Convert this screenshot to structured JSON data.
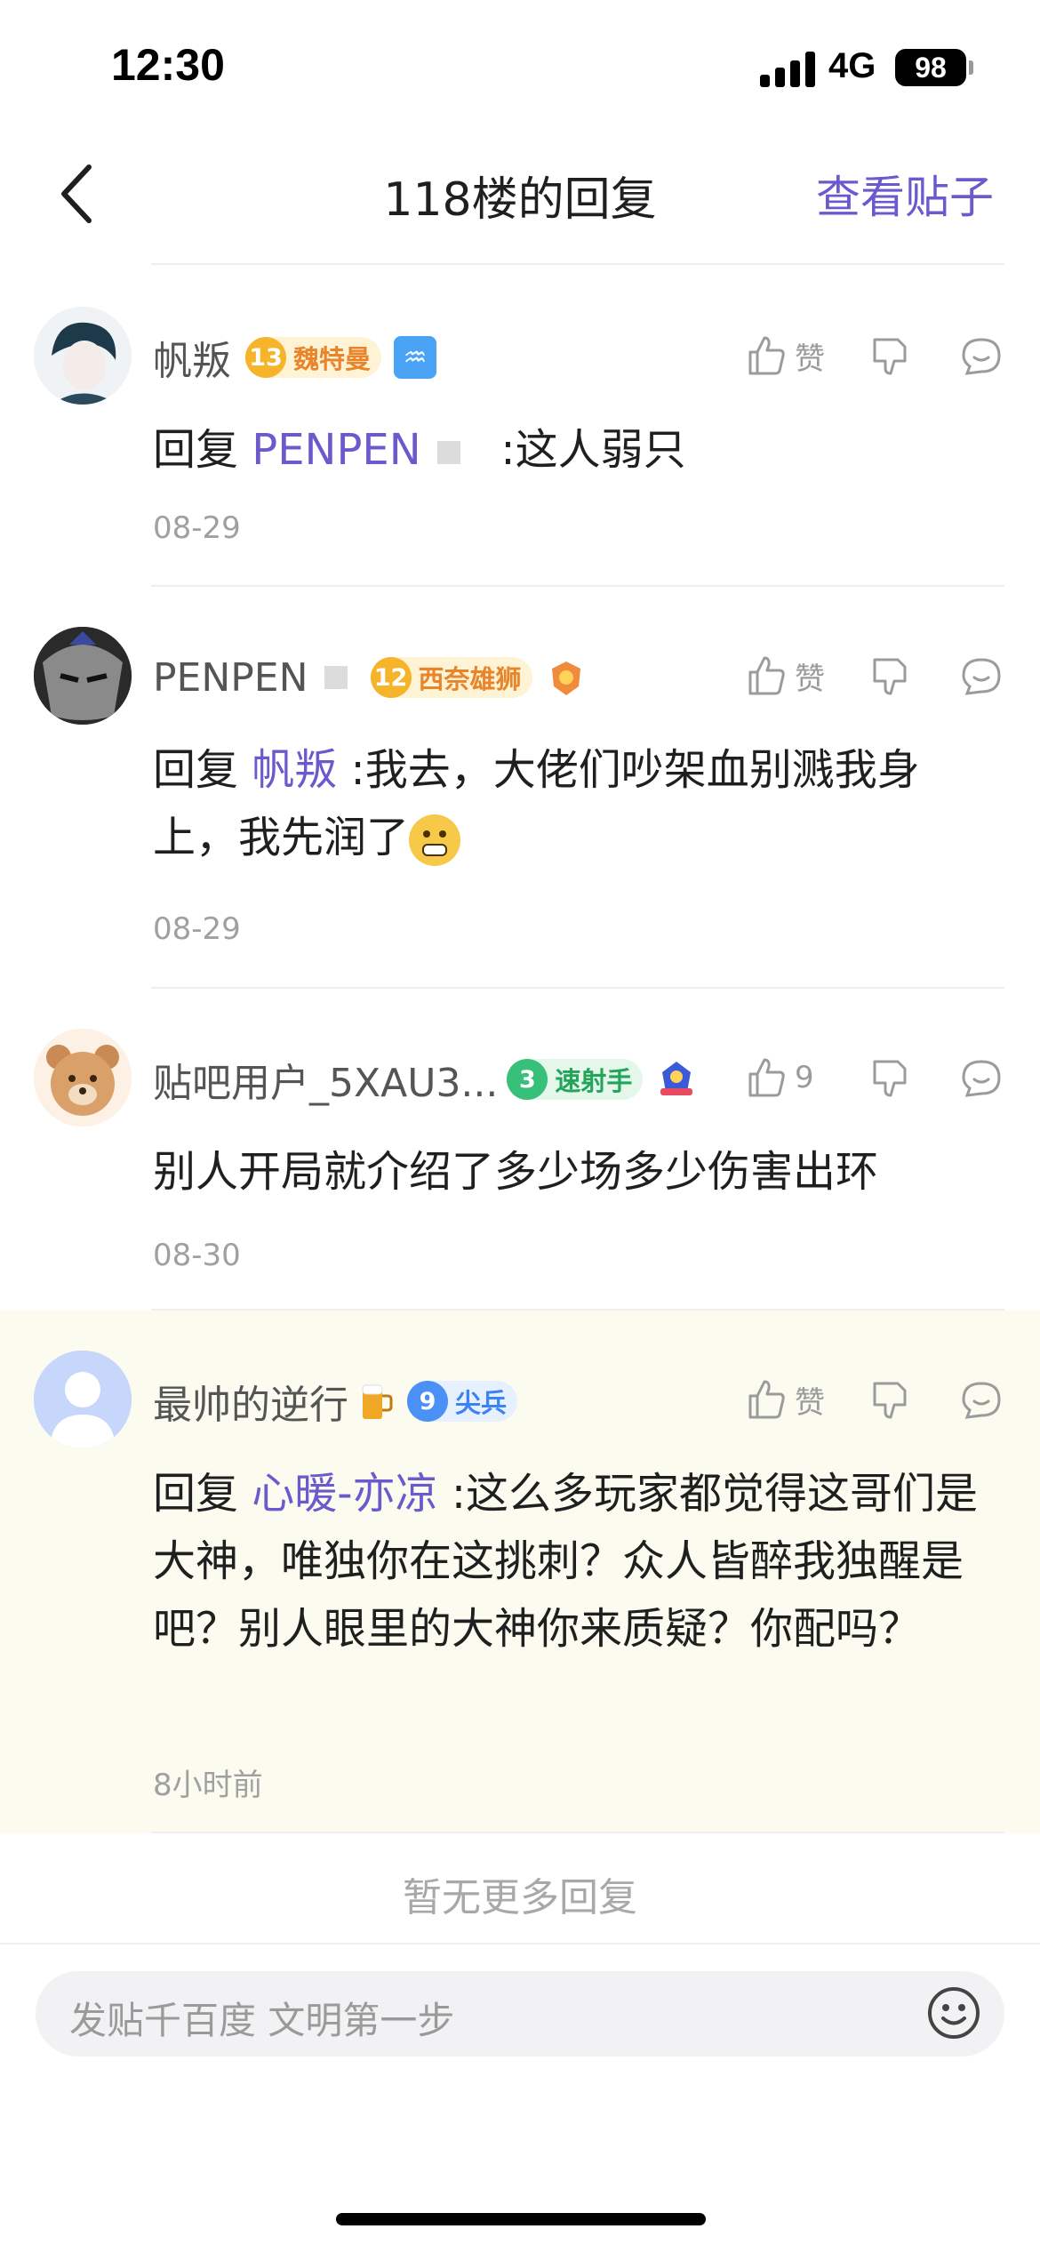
{
  "status_bar": {
    "time": "12:30",
    "network": "4G",
    "battery": "98"
  },
  "nav": {
    "title": "118楼的回复",
    "action": "查看贴子"
  },
  "replies": [
    {
      "username": "帆叛",
      "badge": {
        "level": "13",
        "text": "魏特曼"
      },
      "like_label": "赞",
      "reply_prefix": "回复 ",
      "mention": "PENPEN",
      "text": ":这人弱只",
      "time": "08-29"
    },
    {
      "username": "PENPEN",
      "badge": {
        "level": "12",
        "text": "西奈雄狮"
      },
      "like_label": "赞",
      "reply_prefix": "回复 ",
      "mention": "帆叛",
      "text": " :我去，大佬们吵架血别溅我身上，我先润了",
      "time": "08-29"
    },
    {
      "username": "贴吧用户_5XAU3...",
      "badge": {
        "level": "3",
        "text": "速射手"
      },
      "like_label": "9",
      "text": "别人开局就介绍了多少场多少伤害出环",
      "time": "08-30"
    },
    {
      "username": "最帅的逆行",
      "badge": {
        "level": "9",
        "text": "尖兵"
      },
      "like_label": "赞",
      "reply_prefix": "回复 ",
      "mention": "心暖-亦凉",
      "text": " :这么多玩家都觉得这哥们是大神，唯独你在这挑刺？众人皆醉我独醒是吧？别人眼里的大神你来质疑？你配吗？",
      "time": "8小时前"
    }
  ],
  "footer": {
    "no_more": "暂无更多回复"
  },
  "composer": {
    "placeholder": "发贴千百度 文明第一步"
  },
  "colors": {
    "accent": "#6a5acd",
    "highlight_bg": "#fbfbf0"
  }
}
